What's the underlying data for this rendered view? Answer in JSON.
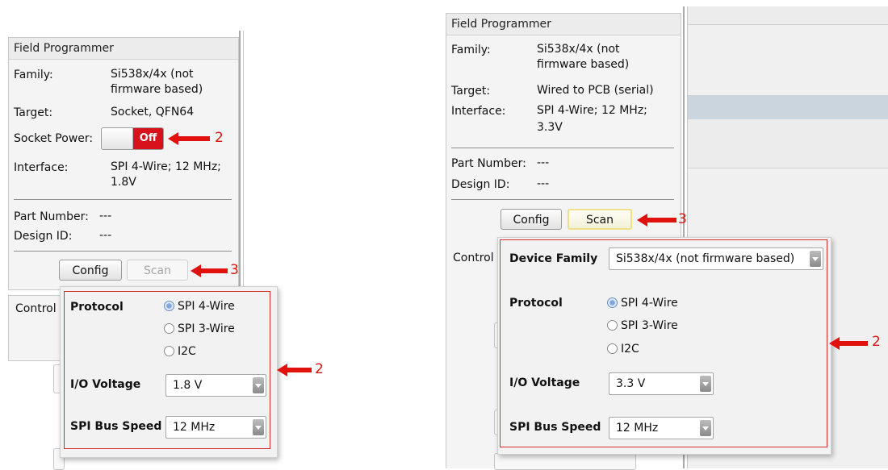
{
  "left": {
    "panel_title": "Field Programmer",
    "family_label": "Family:",
    "family_value_line1": "Si538x/4x (not",
    "family_value_line2": "firmware based)",
    "target_label": "Target:",
    "target_value": "Socket, QFN64",
    "socket_power_label": "Socket Power:",
    "socket_power_state": "Off",
    "interface_label": "Interface:",
    "interface_value_line1": "SPI 4-Wire; 12 MHz;",
    "interface_value_line2": "1.8V",
    "part_number_label": "Part Number:",
    "part_number_value": "---",
    "design_id_label": "Design ID:",
    "design_id_value": "---",
    "config_button": "Config",
    "scan_button": "Scan",
    "control_tab": "Control",
    "annotation_toggle": "2",
    "annotation_scan": "3",
    "annotation_popup": "2",
    "popup": {
      "protocol_label": "Protocol",
      "protocol_options": [
        "SPI 4-Wire",
        "SPI 3-Wire",
        "I2C"
      ],
      "protocol_selected": "SPI 4-Wire",
      "io_voltage_label": "I/O Voltage",
      "io_voltage_value": "1.8 V",
      "bus_speed_label": "SPI Bus Speed",
      "bus_speed_value": "12 MHz"
    }
  },
  "right": {
    "panel_title": "Field Programmer",
    "family_label": "Family:",
    "family_value_line1": "Si538x/4x (not",
    "family_value_line2": "firmware based)",
    "target_label": "Target:",
    "target_value": "Wired to PCB (serial)",
    "interface_label": "Interface:",
    "interface_value_line1": "SPI 4-Wire; 12 MHz;",
    "interface_value_line2": "3.3V",
    "part_number_label": "Part Number:",
    "part_number_value": "---",
    "design_id_label": "Design ID:",
    "design_id_value": "---",
    "config_button": "Config",
    "scan_button": "Scan",
    "control_tab": "Control",
    "annotation_scan": "3",
    "annotation_popup": "2",
    "popup": {
      "device_family_label": "Device Family",
      "device_family_value": "Si538x/4x (not firmware based)",
      "protocol_label": "Protocol",
      "protocol_options": [
        "SPI 4-Wire",
        "SPI 3-Wire",
        "I2C"
      ],
      "protocol_selected": "SPI 4-Wire",
      "io_voltage_label": "I/O Voltage",
      "io_voltage_value": "3.3 V",
      "bus_speed_label": "SPI Bus Speed",
      "bus_speed_value": "12 MHz"
    }
  },
  "colors": {
    "annotation_red": "#e1120e",
    "toggle_off_red": "#d8121a",
    "popup_outline_red": "#d52b2b",
    "scan_highlight": "#efe08a"
  }
}
